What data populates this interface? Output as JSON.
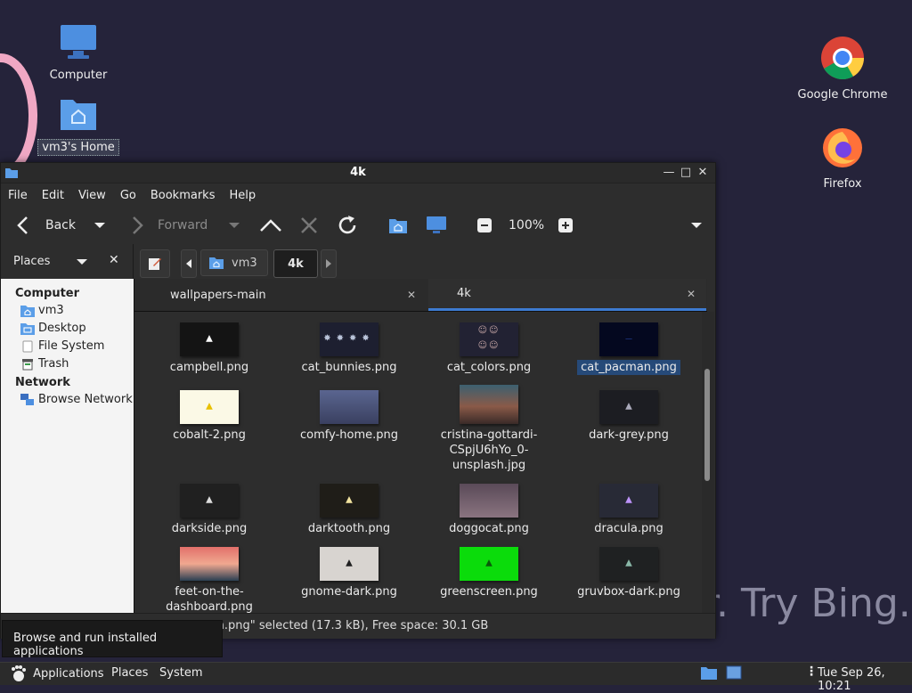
{
  "desktop": {
    "icons": [
      {
        "label": "Computer"
      },
      {
        "label": "vm3's Home"
      },
      {
        "label": "Google Chrome"
      },
      {
        "label": "Firefox"
      }
    ],
    "bing_text": "r. Try Bing."
  },
  "window": {
    "title": "4k",
    "menu": [
      "File",
      "Edit",
      "View",
      "Go",
      "Bookmarks",
      "Help"
    ],
    "toolbar": {
      "back": "Back",
      "forward": "Forward",
      "zoom": "100%"
    },
    "places_label": "Places",
    "path": [
      "vm3",
      "4k"
    ],
    "tabs": [
      {
        "label": "wallpapers-main"
      },
      {
        "label": "4k"
      }
    ],
    "sidebar": {
      "computer_header": "Computer",
      "computer_items": [
        "vm3",
        "Desktop",
        "File System",
        "Trash"
      ],
      "network_header": "Network",
      "network_items": [
        "Browse Network"
      ]
    },
    "files": [
      {
        "name": "campbell.png",
        "thumb_bg": "#141414",
        "glyph": "#ffffff"
      },
      {
        "name": "cat_bunnies.png",
        "thumb_bg": "#1d1f30",
        "glyph": "#b9c3d9"
      },
      {
        "name": "cat_colors.png",
        "thumb_bg": "#222233",
        "glyph": "#c8a8a8"
      },
      {
        "name": "cat_pacman.png",
        "thumb_bg": "#04081f",
        "glyph": "#2848a8"
      },
      {
        "name": "cobalt-2.png",
        "thumb_bg": "#fbf9e6",
        "glyph": "#e8c000"
      },
      {
        "name": "comfy-home.png",
        "thumb_bg": "#4a5578",
        "glyph": "#d8b0c0"
      },
      {
        "name": "cristina-gottardi-CSpjU6hYo_0-unsplash.jpg",
        "thumb_bg": "#6b4a3e",
        "glyph": "#c0c8d8"
      },
      {
        "name": "dark-grey.png",
        "thumb_bg": "#1c1d22",
        "glyph": "#aab"
      },
      {
        "name": "darkside.png",
        "thumb_bg": "#202020",
        "glyph": "#dddddd"
      },
      {
        "name": "darktooth.png",
        "thumb_bg": "#1f1d18",
        "glyph": "#f2e4a0"
      },
      {
        "name": "doggocat.png",
        "thumb_bg": "#6e5a66",
        "glyph": "#e0c8d0"
      },
      {
        "name": "dracula.png",
        "thumb_bg": "#282a36",
        "glyph": "#bd93f9"
      },
      {
        "name": "feet-on-the-dashboard.png",
        "thumb_bg": "#e2706a",
        "glyph": "#2a3f52"
      },
      {
        "name": "gnome-dark.png",
        "thumb_bg": "#d8d4d0",
        "glyph": "#202020"
      },
      {
        "name": "greenscreen.png",
        "thumb_bg": "#0bdc0b",
        "glyph": "#0a5a0a"
      },
      {
        "name": "gruvbox-dark.png",
        "thumb_bg": "#1f2122",
        "glyph": "#8ab8a8"
      }
    ],
    "status": "\"cat_pacman.png\" selected (17.3 kB), Free space: 30.1 GB"
  },
  "tooltip": "Browse and run installed applications",
  "panel": {
    "applications": "Applications",
    "places": "Places",
    "system": "System",
    "clock": "Tue Sep 26, 10:21"
  },
  "colors": {
    "accent": "#3d7bd1",
    "desktop_bg": "#25233a",
    "selection": "#264a79"
  }
}
